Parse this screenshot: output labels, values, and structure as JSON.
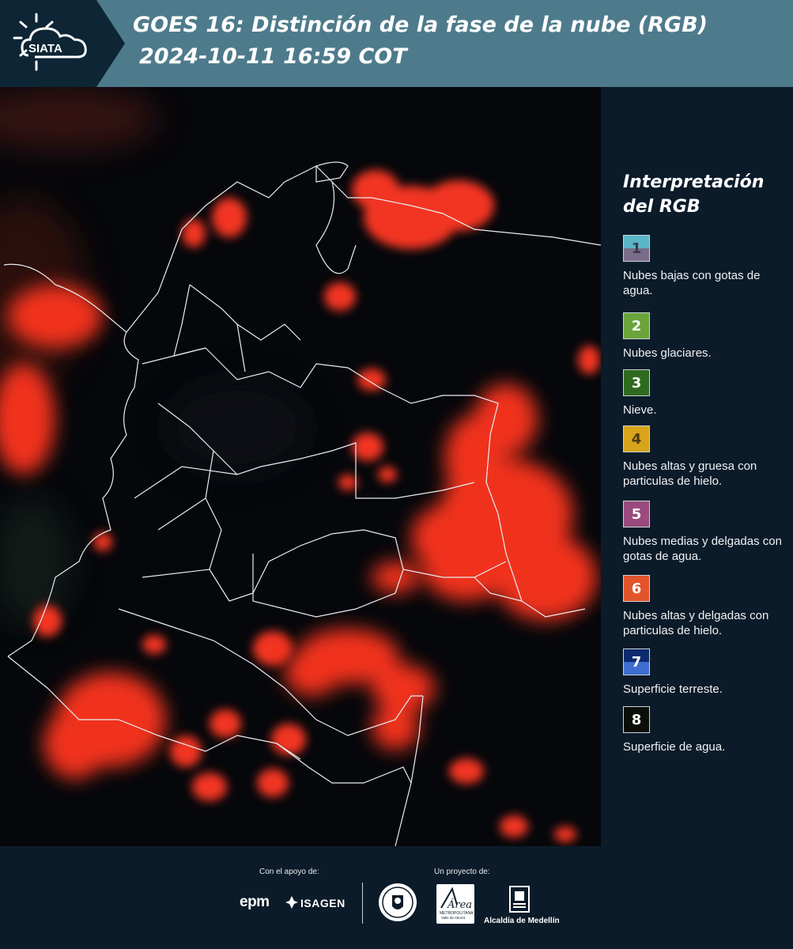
{
  "header": {
    "logo_text": "SIATA",
    "title_line1": "GOES 16: Distinción de la fase de la nube (RGB)",
    "title_line2": "2024-10-11 16:59 COT",
    "logo_icon": "siata-sun-cloud-icon"
  },
  "map": {
    "description_icon": "satellite-map"
  },
  "legend": {
    "title_line1": "Interpretación",
    "title_line2": "del RGB",
    "items": [
      {
        "number": "1",
        "label": "Nubes bajas con gotas de agua.",
        "color_top": "#5ab5c7",
        "color_bottom": "#7a6d8a",
        "text_color": "#3a3a4a"
      },
      {
        "number": "2",
        "label": "Nubes glaciares.",
        "color_top": "#6aa43a",
        "color_bottom": "#6aa43a",
        "text_color": "#ffffff"
      },
      {
        "number": "3",
        "label": "Nieve.",
        "color_top": "#2e6a1f",
        "color_bottom": "#2e6a1f",
        "text_color": "#ffffff"
      },
      {
        "number": "4",
        "label": "Nubes altas y gruesa con particulas de hielo.",
        "color_top": "#d8a41c",
        "color_bottom": "#d8a41c",
        "text_color": "#4a3a10"
      },
      {
        "number": "5",
        "label": "Nubes medias y delgadas con gotas de agua.",
        "color_top": "#9a4a7e",
        "color_bottom": "#9a4a7e",
        "text_color": "#ffffff"
      },
      {
        "number": "6",
        "label": "Nubes altas y delgadas con particulas de hielo.",
        "color_top": "#e2542c",
        "color_bottom": "#e2542c",
        "text_color": "#ffffff"
      },
      {
        "number": "7",
        "label": "Superficie terreste.",
        "color_top": "#0e2a6e",
        "color_bottom": "#3e6fd0",
        "text_color": "#ffffff"
      },
      {
        "number": "8",
        "label": "Superficie de agua.",
        "color_top": "#0a0f0a",
        "color_bottom": "#0a0f0a",
        "text_color": "#ffffff"
      }
    ]
  },
  "footer": {
    "support_label": "Con el apoyo de:",
    "project_label": "Un proyecto de:",
    "epm": "epm",
    "isagen": "ISAGEN",
    "area_logo_text": "Área",
    "area_sub1": "METROPOLITANA",
    "area_sub2": "Valle de Aburrá",
    "alcaldia": "Alcaldía de Medellín"
  }
}
